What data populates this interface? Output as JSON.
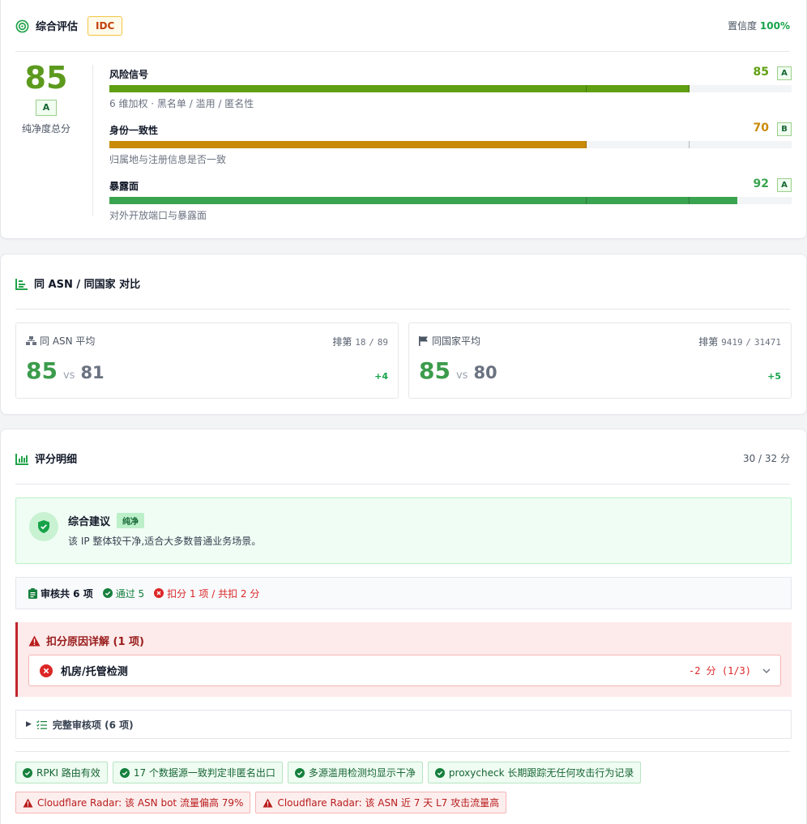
{
  "overview": {
    "title": "综合评估",
    "type_badge": "IDC",
    "confidence_label": "置信度",
    "confidence_value": "100%",
    "total_score": "85",
    "total_grade": "A",
    "total_label": "纯净度总分",
    "metrics": [
      {
        "name": "风险信号",
        "score": "85",
        "grade": "A",
        "desc": "6 维加权 · 黑名单 / 滥用 / 匿名性",
        "value": 85,
        "color": "#5fa012"
      },
      {
        "name": "身份一致性",
        "score": "70",
        "grade": "B",
        "desc": "归属地与注册信息是否一致",
        "value": 70,
        "color": "#c98a09"
      },
      {
        "name": "暴露面",
        "score": "92",
        "grade": "A",
        "desc": "对外开放端口与暴露面",
        "value": 92,
        "color": "#3aa350"
      }
    ]
  },
  "comparison": {
    "title": "同 ASN / 同国家 对比",
    "asn": {
      "label": "同 ASN 平均",
      "rank_label": "排第",
      "rank": "18",
      "rank_sep": "/",
      "rank_total": "89",
      "score": "85",
      "vs": "vs",
      "other": "81",
      "diff": "+4"
    },
    "country": {
      "label": "同国家平均",
      "rank_label": "排第",
      "rank": "9419",
      "rank_sep": "/",
      "rank_total": "31471",
      "score": "85",
      "vs": "vs",
      "other": "80",
      "diff": "+5"
    }
  },
  "details": {
    "title": "评分明细",
    "units": "30 / 32 分",
    "advice_title": "综合建议",
    "advice_badge": "纯净",
    "advice_text": "该 IP 整体较干净,适合大多数普通业务场景。",
    "audit_total": "审核共 6 项",
    "audit_pass": "通过 5",
    "audit_deduct": "扣分 1 项 / 共扣 2 分",
    "deduct_title": "扣分原因详解 (1 项)",
    "deduct_item": "机房/托管检测",
    "deduct_points": "-2 分 (1/3)",
    "full_audit": "完整审核项 (6 项)",
    "pass_chips": [
      "RPKI 路由有效",
      "17 个数据源一致判定非匿名出口",
      "多源滥用检测均显示干净",
      "proxycheck 长期跟踪无任何攻击行为记录"
    ],
    "warn_chips": [
      "Cloudflare Radar: 该 ASN bot 流量偏高 79%",
      "Cloudflare Radar: 该 ASN 近 7 天 L7 攻击流量高"
    ]
  }
}
